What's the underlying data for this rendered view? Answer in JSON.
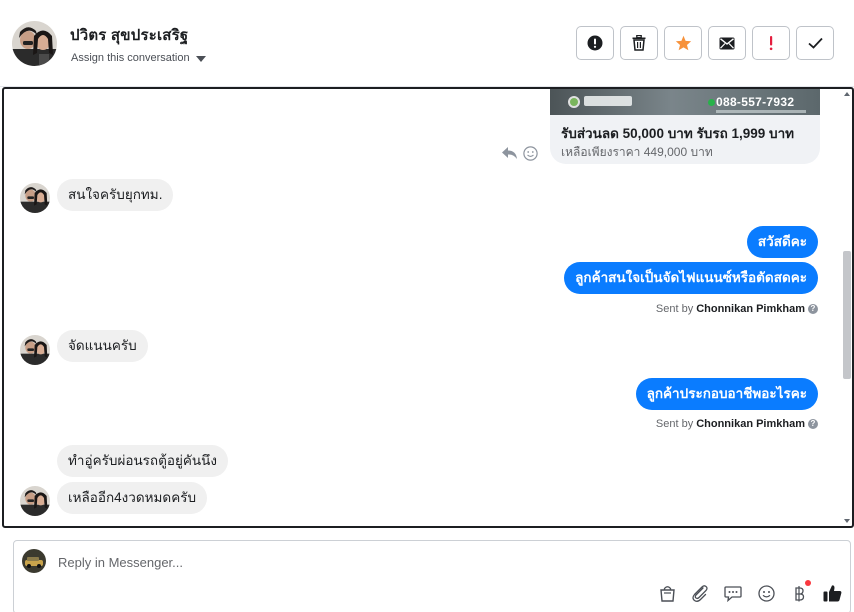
{
  "header": {
    "contact_name": "ปวิตร สุขประเสริฐ",
    "assign_label": "Assign this conversation",
    "actions": [
      {
        "name": "spam-button",
        "icon": "alert-circle-icon"
      },
      {
        "name": "delete-button",
        "icon": "trash-icon"
      },
      {
        "name": "star-button",
        "icon": "star-icon",
        "color": "#f7923b"
      },
      {
        "name": "mark-unread-button",
        "icon": "envelope-icon"
      },
      {
        "name": "follow-up-button",
        "icon": "exclamation-icon",
        "color": "#e41e3f"
      },
      {
        "name": "done-button",
        "icon": "checkmark-icon"
      }
    ]
  },
  "thread": {
    "ad_card": {
      "phone": "088-557-7932",
      "title": "รับส่วนลด 50,000 บาท รับรถ 1,999 บาท",
      "description": "เหลือเพียงราคา 449,000 บาท"
    },
    "messages": [
      {
        "direction": "in",
        "text": "สนใจครับยุกทม."
      },
      {
        "direction": "out",
        "text": "สวัสดีคะ"
      },
      {
        "direction": "out",
        "text": "ลูกค้าสนใจเป็นจัดไฟแนนซ์หรือตัดสดคะ"
      },
      {
        "direction": "in",
        "text": "จัดแนนครับ"
      },
      {
        "direction": "out",
        "text": "ลูกค้าประกอบอาชีพอะไรคะ"
      },
      {
        "direction": "in",
        "text": "ทำอู่ครับผ่อนรถตู้อยู่คันนึง"
      },
      {
        "direction": "in",
        "text": "เหลืออีก4งวดหมดครับ"
      }
    ],
    "sent_by_prefix": "Sent by",
    "sent_by_name": "Chonnikan Pimkham",
    "help_glyph": "?"
  },
  "composer": {
    "placeholder": "Reply in Messenger...",
    "tools": [
      "bag-icon",
      "paperclip-icon",
      "chat-bubble-icon",
      "smiley-icon",
      "baht-icon",
      "thumbs-up-icon"
    ],
    "accent_color": "#0a7cff",
    "notification_color": "#fa383e"
  }
}
